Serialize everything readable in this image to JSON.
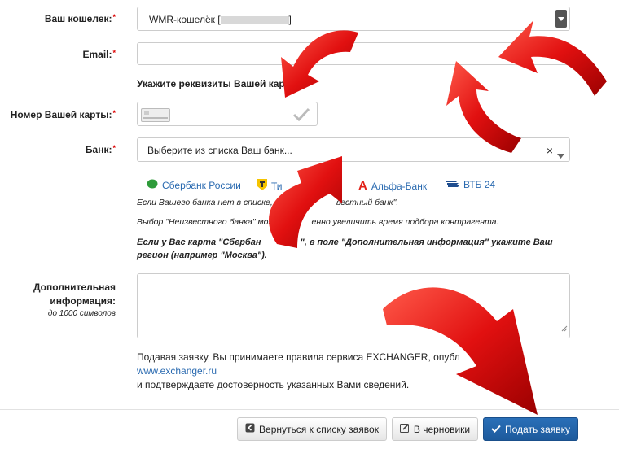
{
  "form": {
    "wallet_label": "Ваш кошелек:",
    "wallet_value": "WMR-кошелёк [",
    "wallet_value_end": "]",
    "email_label": "Email:",
    "email_value": "",
    "card_section_title": "Укажите реквизиты Вашей карты",
    "card_label": "Номер Вашей карты:",
    "bank_label": "Банк:",
    "bank_placeholder": "Выберите из списка Ваш банк...",
    "bank_clear": "×",
    "banks": [
      {
        "name": "Сбербанк России",
        "icon": "sberbank-icon",
        "color": "#2e9b3a"
      },
      {
        "name": "Ти",
        "icon": "tinkoff-icon",
        "color": "#f5c400"
      },
      {
        "name": "Альфа-Банк",
        "icon": "alfa-bank-icon",
        "color": "#e2231a"
      },
      {
        "name": "ВТБ 24",
        "icon": "vtb-icon",
        "color": "#1f4d8f"
      }
    ],
    "note1_a": "Если Вашего банка нет в списке, вы",
    "note1_b": "вестный банк\".",
    "note2_a": "Выбор \"Неизвестного банка\" мож",
    "note2_b": "енно увеличить время подбора контрагента.",
    "note3_a": "Если у Вас карта \"Сбербан",
    "note3_b": "\", в поле \"Дополнительная информация\" укажите Ваш",
    "note3_c": "регион (например \"Москва\").",
    "extra_label_1": "Дополнительная",
    "extra_label_2": "информация:",
    "extra_hint": "до 1000 символов",
    "agree_a": "Подавая заявку, Вы принимаете правила сервиса EXCHANGER, опубл",
    "agree_link": "www.exchanger.ru",
    "agree_c": "и подтверждаете достоверность указанных Вами сведений."
  },
  "buttons": {
    "back": "Вернуться к списку заявок",
    "draft": "В черновики",
    "submit": "Подать заявку"
  },
  "icons": [
    "arrow-left-icon",
    "edit-icon",
    "check-icon",
    "caret-down-icon",
    "checkmark-icon",
    "card-icon"
  ],
  "colors": {
    "accent": "#1d5a9c",
    "link": "#2a6ab0",
    "arrow": "#e11010"
  }
}
